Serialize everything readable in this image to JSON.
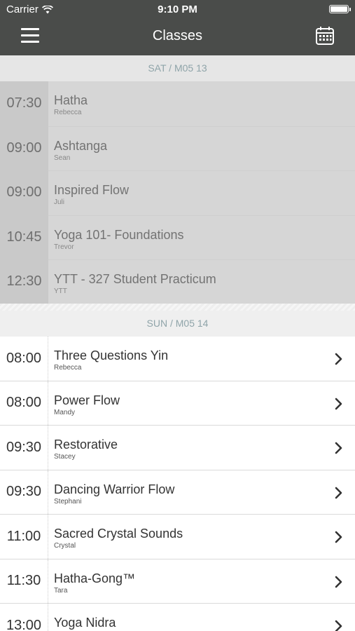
{
  "status_bar": {
    "carrier": "Carrier",
    "time": "9:10 PM"
  },
  "nav": {
    "title": "Classes",
    "menu_icon": "hamburger-icon",
    "calendar_icon": "calendar-icon"
  },
  "days": [
    {
      "header": "SAT / M05 13",
      "past": true,
      "classes": [
        {
          "time": "07:30",
          "title": "Hatha",
          "teacher": "Rebecca"
        },
        {
          "time": "09:00",
          "title": "Ashtanga",
          "teacher": "Sean"
        },
        {
          "time": "09:00",
          "title": "Inspired Flow",
          "teacher": "Juli"
        },
        {
          "time": "10:45",
          "title": "Yoga 101- Foundations",
          "teacher": "Trevor"
        },
        {
          "time": "12:30",
          "title": "YTT - 327 Student Practicum",
          "teacher": "YTT"
        }
      ]
    },
    {
      "header": "SUN / M05 14",
      "past": false,
      "classes": [
        {
          "time": "08:00",
          "title": "Three Questions Yin",
          "teacher": "Rebecca"
        },
        {
          "time": "08:00",
          "title": "Power Flow",
          "teacher": "Mandy"
        },
        {
          "time": "09:30",
          "title": "Restorative",
          "teacher": "Stacey"
        },
        {
          "time": "09:30",
          "title": "Dancing Warrior Flow",
          "teacher": "Stephani"
        },
        {
          "time": "11:00",
          "title": "Sacred Crystal Sounds",
          "teacher": "Crystal"
        },
        {
          "time": "11:30",
          "title": "Hatha-Gong™",
          "teacher": "Tara"
        },
        {
          "time": "13:00",
          "title": "Yoga Nidra",
          "teacher": ""
        }
      ]
    }
  ],
  "colors": {
    "header_bg": "#4a4c4a",
    "day_header_text": "#8fa4a9",
    "past_row_bg": "#d6d6d6"
  }
}
